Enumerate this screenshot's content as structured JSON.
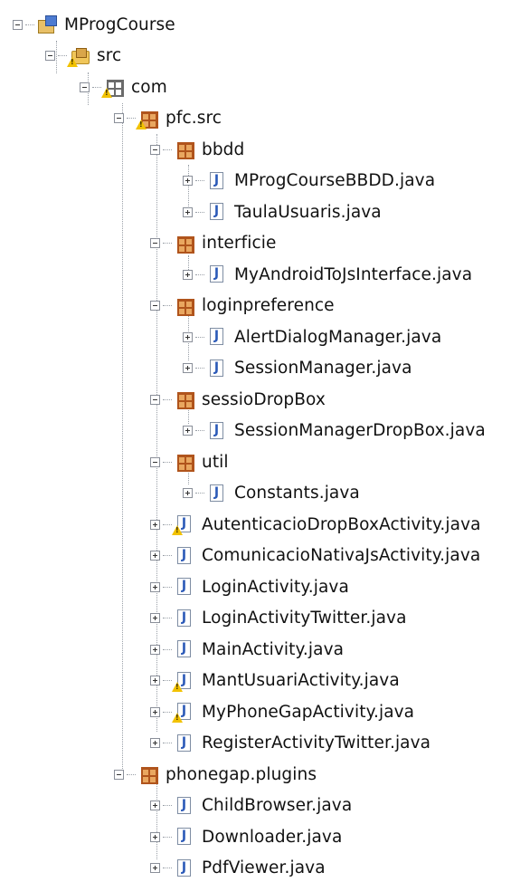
{
  "tree": [
    {
      "label": "MProgCourse",
      "icon": "project-icon",
      "toggle": "minus",
      "depth": 0,
      "warning": false
    },
    {
      "label": "src",
      "icon": "source-folder-icon",
      "toggle": "minus",
      "depth": 1,
      "warning": true
    },
    {
      "label": "com",
      "icon": "package-icon",
      "toggle": "minus",
      "depth": 2,
      "warning": true
    },
    {
      "label": "pfc.src",
      "icon": "package-icon",
      "toggle": "minus",
      "depth": 3,
      "warning": true
    },
    {
      "label": "bbdd",
      "icon": "package-icon",
      "toggle": "minus",
      "depth": 4,
      "warning": false
    },
    {
      "label": "MProgCourseBBDD.java",
      "icon": "java-file-icon",
      "toggle": "plus",
      "depth": 5,
      "warning": false
    },
    {
      "label": "TaulaUsuaris.java",
      "icon": "java-file-icon",
      "toggle": "plus",
      "depth": 5,
      "warning": false
    },
    {
      "label": "interficie",
      "icon": "package-icon",
      "toggle": "minus",
      "depth": 4,
      "warning": false
    },
    {
      "label": "MyAndroidToJsInterface.java",
      "icon": "java-file-icon",
      "toggle": "plus",
      "depth": 5,
      "warning": false
    },
    {
      "label": "loginpreference",
      "icon": "package-icon",
      "toggle": "minus",
      "depth": 4,
      "warning": false
    },
    {
      "label": "AlertDialogManager.java",
      "icon": "java-file-icon",
      "toggle": "plus",
      "depth": 5,
      "warning": false
    },
    {
      "label": "SessionManager.java",
      "icon": "java-file-icon",
      "toggle": "plus",
      "depth": 5,
      "warning": false
    },
    {
      "label": "sessioDropBox",
      "icon": "package-icon",
      "toggle": "minus",
      "depth": 4,
      "warning": false
    },
    {
      "label": "SessionManagerDropBox.java",
      "icon": "java-file-icon",
      "toggle": "plus",
      "depth": 5,
      "warning": false
    },
    {
      "label": "util",
      "icon": "package-icon",
      "toggle": "minus",
      "depth": 4,
      "warning": false
    },
    {
      "label": "Constants.java",
      "icon": "java-file-icon",
      "toggle": "plus",
      "depth": 5,
      "warning": false
    },
    {
      "label": "AutenticacioDropBoxActivity.java",
      "icon": "java-file-icon",
      "toggle": "plus",
      "depth": 4,
      "warning": true
    },
    {
      "label": "ComunicacioNativaJsActivity.java",
      "icon": "java-file-icon",
      "toggle": "plus",
      "depth": 4,
      "warning": false
    },
    {
      "label": "LoginActivity.java",
      "icon": "java-file-icon",
      "toggle": "plus",
      "depth": 4,
      "warning": false
    },
    {
      "label": "LoginActivityTwitter.java",
      "icon": "java-file-icon",
      "toggle": "plus",
      "depth": 4,
      "warning": false
    },
    {
      "label": "MainActivity.java",
      "icon": "java-file-icon",
      "toggle": "plus",
      "depth": 4,
      "warning": false
    },
    {
      "label": "MantUsuariActivity.java",
      "icon": "java-file-icon",
      "toggle": "plus",
      "depth": 4,
      "warning": true
    },
    {
      "label": "MyPhoneGapActivity.java",
      "icon": "java-file-icon",
      "toggle": "plus",
      "depth": 4,
      "warning": true
    },
    {
      "label": "RegisterActivityTwitter.java",
      "icon": "java-file-icon",
      "toggle": "plus",
      "depth": 4,
      "warning": false
    },
    {
      "label": "phonegap.plugins",
      "icon": "package-icon",
      "toggle": "minus",
      "depth": 3,
      "warning": false
    },
    {
      "label": "ChildBrowser.java",
      "icon": "java-file-icon",
      "toggle": "plus",
      "depth": 4,
      "warning": false
    },
    {
      "label": "Downloader.java",
      "icon": "java-file-icon",
      "toggle": "plus",
      "depth": 4,
      "warning": false
    },
    {
      "label": "PdfViewer.java",
      "icon": "java-file-icon",
      "toggle": "plus",
      "depth": 4,
      "warning": false
    }
  ],
  "colors": {
    "background": "#ffffff",
    "java_letter": "#2c5ab8",
    "package_warm": "#e9a760",
    "warning": "#f2c200"
  }
}
